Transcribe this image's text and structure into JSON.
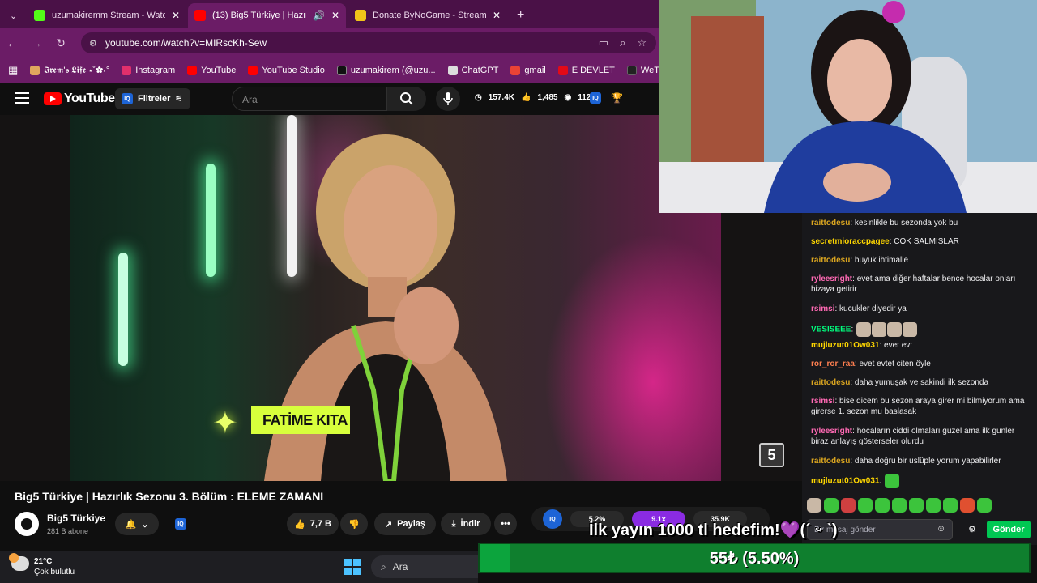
{
  "browser": {
    "tabs": [
      {
        "label": "uzumakiremm Stream - Watch",
        "favicon_color": "#53fc18",
        "active": false
      },
      {
        "label": "(13) Big5 Türkiye | Hazırlık S",
        "favicon_color": "#ff0000",
        "active": true
      },
      {
        "label": "Donate ByNoGame - Streamer",
        "favicon_color": "#f0c419",
        "active": false
      }
    ],
    "new_tab_symbol": "+",
    "url": "youtube.com/watch?v=MIRscKh-Sew",
    "bookmarks": [
      {
        "label": "𝕴𝖗𝖊𝖒'𝖘 𝕷𝖎𝖋𝖊 ⋆˚✿˖°",
        "icon": "bookmark-icon",
        "color": "#e0a75e"
      },
      {
        "label": "Instagram",
        "icon": "instagram-icon",
        "color": "#e1306c"
      },
      {
        "label": "YouTube",
        "icon": "youtube-icon",
        "color": "#ff0000"
      },
      {
        "label": "YouTube Studio",
        "icon": "youtube-studio-icon",
        "color": "#ff0000"
      },
      {
        "label": "uzumakirem (@uzu...",
        "icon": "tiktok-icon",
        "color": "#111111"
      },
      {
        "label": "ChatGPT",
        "icon": "chatgpt-icon",
        "color": "#dddddd"
      },
      {
        "label": "gmail",
        "icon": "gmail-icon",
        "color": "#ea4335"
      },
      {
        "label": "E DEVLET",
        "icon": "edevlet-icon",
        "color": "#e30a17"
      },
      {
        "label": "WeTransfe",
        "icon": "wetransfer-icon",
        "color": "#222222"
      }
    ]
  },
  "youtube": {
    "logo_text": "YouTube",
    "region": "TR",
    "filters_label": "Filtreler",
    "iq_label": "IQ",
    "search_placeholder": "Ara",
    "stats": [
      "157.4K",
      "1,485",
      "112K"
    ],
    "video": {
      "title": "Big5 Türkiye | Hazırlık Sezonu 3. Bölüm : ELEME ZAMANI",
      "name_tag": "FATİME KITA",
      "channel_bug": "5"
    },
    "channel": {
      "name": "Big5 Türkiye",
      "subscribers": "281 B abone"
    },
    "likes": "7,7 B",
    "share_label": "Paylaş",
    "download_label": "İndir",
    "iq_stats": [
      "5.2%",
      "9.1x",
      "35.9K"
    ]
  },
  "chat": {
    "messages": [
      {
        "user": "raittodesu",
        "color": "#daa520",
        "text": "kesinlikle bu sezonda yok bu"
      },
      {
        "user": "secretmioraccpagee",
        "color": "#ffd700",
        "text": "COK SALMISLAR"
      },
      {
        "user": "raittodesu",
        "color": "#daa520",
        "text": "büyük ihtimalle"
      },
      {
        "user": "ryleesright",
        "color": "#ff69b4",
        "text": "evet ama diğer haftalar bence hocalar onları hizaya getirir"
      },
      {
        "user": "rsimsi",
        "color": "#ff69b4",
        "text": "kucukler diyedir ya"
      },
      {
        "user": "VESISEEE",
        "color": "#00ff7f",
        "text": "",
        "emotes": 4
      },
      {
        "user": "mujluzut01Ow031",
        "color": "#ffd700",
        "text": "evet evt"
      },
      {
        "user": "ror_ror_raa",
        "color": "#ff7f50",
        "text": "evet evtet citen öyle"
      },
      {
        "user": "raittodesu",
        "color": "#daa520",
        "text": "daha yumuşak ve sakindi ilk sezonda"
      },
      {
        "user": "rsimsi",
        "color": "#ff69b4",
        "text": "bise dicem bu sezon araya girer mi bilmiyorum ama girerse 1. sezon mu baslasak"
      },
      {
        "user": "ryleesright",
        "color": "#ff69b4",
        "text": "hocaların ciddi olmaları güzel ama ilk günler biraz anlayış gösterseler olurdu"
      },
      {
        "user": "raittodesu",
        "color": "#daa520",
        "text": "daha doğru bir uslüple yorum yapabilirler"
      },
      {
        "user": "mujluzut01Ow031",
        "color": "#ffd700",
        "text": "",
        "emotes": 1
      }
    ],
    "emote_colors": [
      "#c9b8a6",
      "#3cc43c",
      "#d04040",
      "#3cc43c",
      "#3cc43c",
      "#3cc43c",
      "#3cc43c",
      "#3cc43c",
      "#3cc43c",
      "#e05030",
      "#3cc43c"
    ],
    "input_placeholder": "Bir mesaj gönder",
    "send_label": "Gönder"
  },
  "goal": {
    "text": "İlk yayın 1000 tl hedefim!💜(ˊ ᵕ ˋ)",
    "label": "55₺ (5.50%)",
    "progress_percent": 5.5,
    "bar_color": "#13d85a"
  },
  "taskbar": {
    "temperature": "21°C",
    "condition": "Çok bulutlu",
    "search_label": "Ara"
  }
}
